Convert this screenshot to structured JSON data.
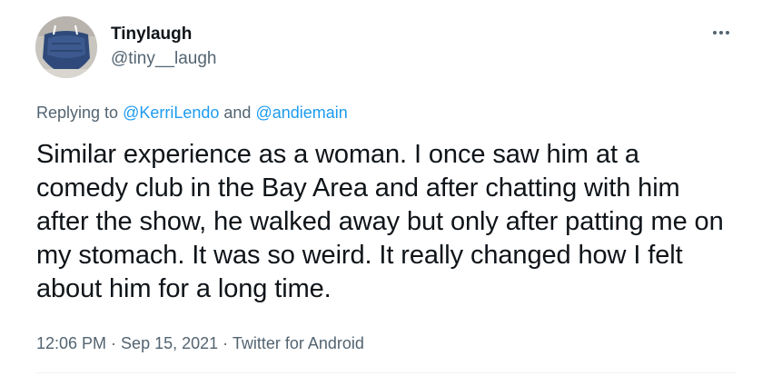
{
  "author": {
    "display_name": "Tinylaugh",
    "handle": "@tiny__laugh"
  },
  "more_icon": "more-horizontal-icon",
  "reply": {
    "prefix": "Replying to ",
    "mention1": "@KerriLendo",
    "conjunction": " and ",
    "mention2": "@andiemain"
  },
  "tweet": {
    "text": "Similar experience as a woman. I once saw him at a comedy club in the Bay Area and after chatting with him after the show, he walked away but only after patting me on my stomach. It was so weird. It really changed how I felt about him for a long time."
  },
  "meta": {
    "time": "12:06 PM",
    "sep1": " · ",
    "date": "Sep 15, 2021",
    "sep2": " · ",
    "source": "Twitter for Android"
  },
  "colors": {
    "link": "#1d9bf0",
    "text": "#0f1419",
    "secondary": "#536471"
  }
}
